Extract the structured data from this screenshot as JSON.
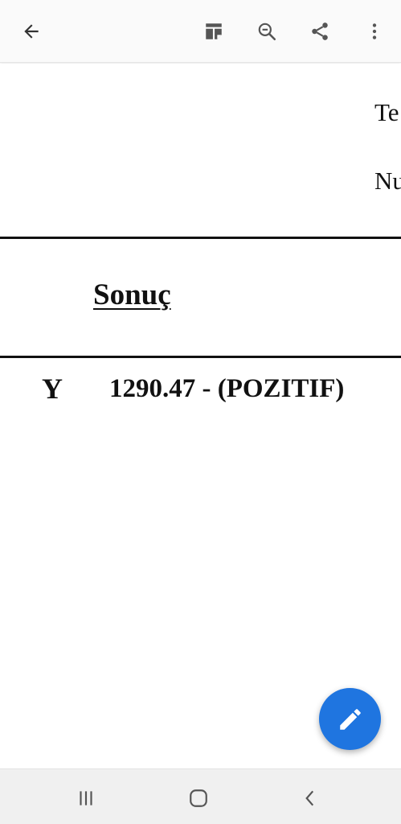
{
  "toolbar": {
    "icons": [
      "back-arrow-icon",
      "reading-mode-icon",
      "search-zoom-icon",
      "share-icon",
      "more-vert-icon"
    ]
  },
  "document": {
    "fragment_top": "Te",
    "fragment_second": "Nu",
    "heading": "Sonuç",
    "row_label": "Y",
    "row_value": "1290.47 - (POZITIF)"
  },
  "fab": {
    "icon": "edit-pencil-icon",
    "color": "#1f75e0"
  },
  "system_nav": {
    "icons": [
      "recents-icon",
      "home-icon",
      "back-icon"
    ]
  }
}
